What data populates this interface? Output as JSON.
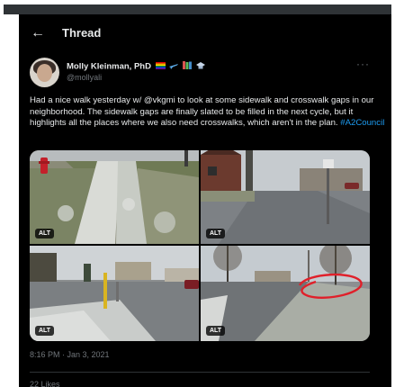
{
  "header": {
    "title": "Thread"
  },
  "tweet": {
    "author_name": "Molly Kleinman, PhD",
    "author_handle": "@mollyali",
    "text_main": "Had a nice walk yesterday w/ @vkgmi to look at some sidewalk and crosswalk gaps in our neighborhood. The sidewalk gaps are finally slated to be filled in the next cycle, but it highlights all the places where we also need crosswalks, which aren't in the plan. ",
    "hashtag": "#A2Council",
    "timestamp": "8:16 PM · Jan 3, 2021",
    "likes_partial": "22 Likes",
    "alt_label": "ALT"
  },
  "colors": {
    "background": "#000000",
    "text": "#e7e9ea",
    "muted": "#71767b",
    "link": "#1d9bf0",
    "annotation": "#e0202a"
  },
  "icons": [
    "back-arrow-icon",
    "more-options-icon",
    "rainbow-flag-icon",
    "airplane-icon",
    "books-icon",
    "graduation-cap-icon"
  ]
}
